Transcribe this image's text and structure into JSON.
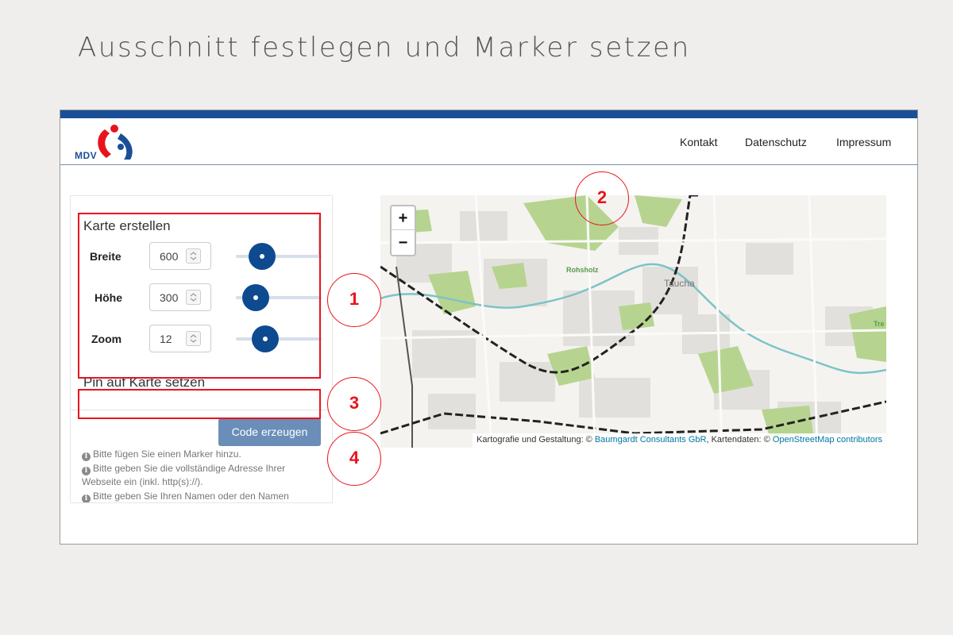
{
  "page_title": "Ausschnitt festlegen und Marker setzen",
  "header": {
    "logo_text": "MDV",
    "nav": [
      "Kontakt",
      "Datenschutz",
      "Impressum"
    ]
  },
  "panel": {
    "title": "Karte erstellen",
    "rows": [
      {
        "label": "Breite",
        "value": "600"
      },
      {
        "label": "Höhe",
        "value": "300"
      },
      {
        "label": "Zoom",
        "value": "12"
      }
    ],
    "pin_title": "Pin auf Karte setzen",
    "button": "Code erzeugen",
    "hints": [
      "Bitte fügen Sie einen Marker hinzu.",
      "Bitte geben Sie die vollständige Adresse Ihrer",
      "Webseite ein (inkl. http(s)://).",
      "Bitte geben Sie Ihren Namen oder den Namen"
    ]
  },
  "map": {
    "zoom_in": "+",
    "zoom_out": "−",
    "labels": [
      "Taucha",
      "Rohsholz",
      "Tre"
    ],
    "attribution": {
      "prefix": "Kartografie und Gestaltung: © ",
      "link1": "Baumgardt Consultants GbR",
      "middle": ", Kartendaten: © ",
      "link2": "OpenStreetMap contributors"
    }
  },
  "annotations": [
    "1",
    "2",
    "3",
    "4"
  ],
  "colors": {
    "accent": "#1a4f98",
    "annotation": "#e8141c",
    "button": "#6b8eb9",
    "slider": "#0e4a8f"
  }
}
